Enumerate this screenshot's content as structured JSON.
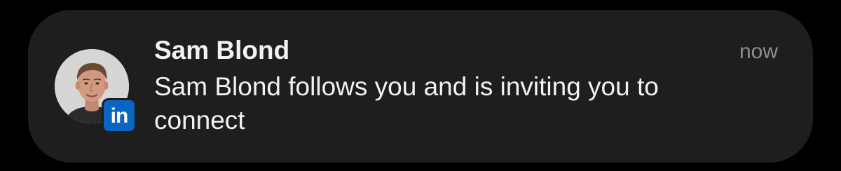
{
  "notification": {
    "app_icon": "linkedin-icon",
    "app_badge_text": "in",
    "app_badge_color": "#0a66c2",
    "background_color": "#1e1e1e",
    "sender": "Sam Blond",
    "time": "now",
    "message": "Sam Blond follows you and is inviting you to connect"
  }
}
